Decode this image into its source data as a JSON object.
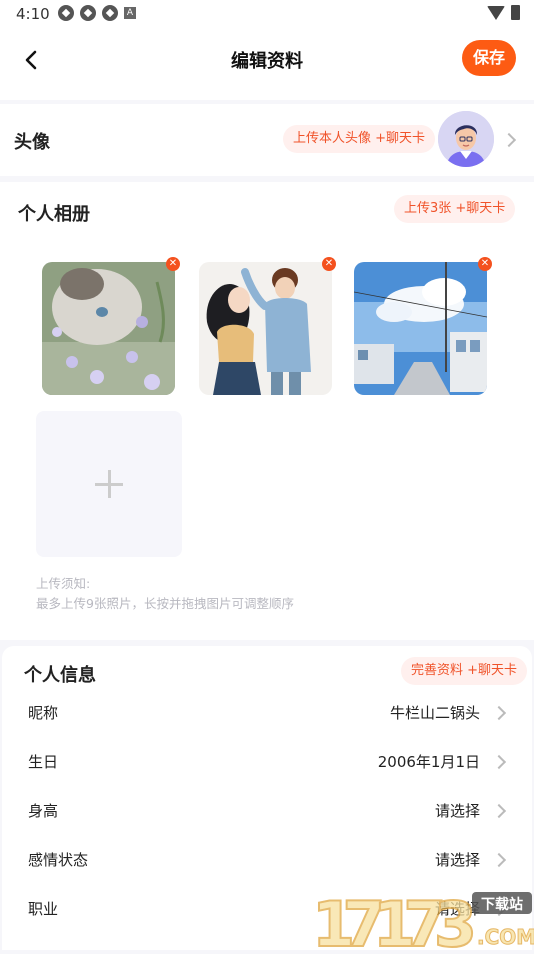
{
  "status_bar": {
    "time": "4:10"
  },
  "header": {
    "title": "编辑资料",
    "save_label": "保存"
  },
  "avatar_section": {
    "label": "头像",
    "reward": "上传本人头像 +聊天卡"
  },
  "album": {
    "title": "个人相册",
    "reward": "上传3张 +聊天卡",
    "photos": [
      {
        "desc": "cat-photo"
      },
      {
        "desc": "couple-illustration"
      },
      {
        "desc": "street-illustration"
      }
    ],
    "tip_title": "上传须知:",
    "tip_body": "最多上传9张照片，长按并拖拽图片可调整顺序"
  },
  "info": {
    "title": "个人信息",
    "reward": "完善资料 +聊天卡",
    "rows": [
      {
        "label": "昵称",
        "value": "牛栏山二锅头"
      },
      {
        "label": "生日",
        "value": "2006年1月1日"
      },
      {
        "label": "身高",
        "value": "请选择"
      },
      {
        "label": "感情状态",
        "value": "请选择"
      },
      {
        "label": "职业",
        "value": "请选择"
      }
    ]
  },
  "watermark": {
    "text": "17173",
    "sub": "下载站",
    "domain": ".COM"
  },
  "colors": {
    "accent": "#fd5b13",
    "pill_bg": "#fff0ee",
    "pill_text": "#f0532a"
  }
}
